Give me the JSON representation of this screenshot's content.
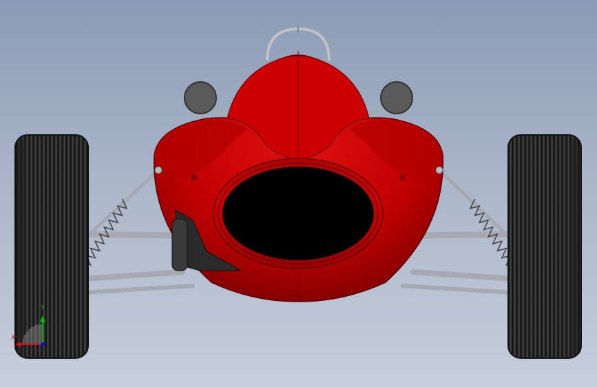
{
  "viewport": {
    "background_top": "#8a9bb5",
    "background_bottom": "#c7cedc"
  },
  "model": {
    "body_color": "#cc0000",
    "body_shadow": "#7a0000",
    "intake_color": "#000000",
    "tire_color": "#2b2b2b",
    "suspension_color": "#a7a9b0",
    "mirror_color": "#555555"
  },
  "triad": {
    "y_label": "Y",
    "x_label": "X",
    "y_color": "#10b010",
    "x_color": "#d01010",
    "z_color": "#1010d0"
  }
}
